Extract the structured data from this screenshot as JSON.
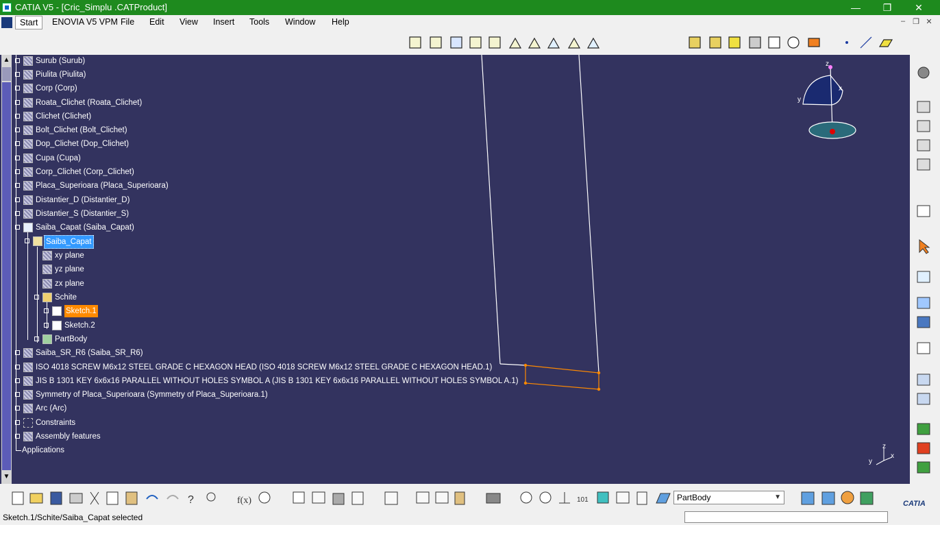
{
  "window": {
    "title": "CATIA V5 - [Cric_Simplu .CATProduct]",
    "minimize": "—",
    "maximize": "❐",
    "close": "✕"
  },
  "menu": {
    "start": "Start",
    "items": [
      "ENOVIA V5 VPM",
      "File",
      "Edit",
      "View",
      "Insert",
      "Tools",
      "Window",
      "Help"
    ]
  },
  "tree": {
    "nodes": [
      {
        "label": "Surub (Surub)"
      },
      {
        "label": "Piulita (Piulita)"
      },
      {
        "label": "Corp (Corp)"
      },
      {
        "label": "Roata_Clichet (Roata_Clichet)"
      },
      {
        "label": "Clichet (Clichet)"
      },
      {
        "label": "Bolt_Clichet (Bolt_Clichet)"
      },
      {
        "label": "Dop_Clichet (Dop_Clichet)"
      },
      {
        "label": "Cupa (Cupa)"
      },
      {
        "label": "Corp_Clichet (Corp_Clichet)"
      },
      {
        "label": "Placa_Superioara (Placa_Superioara)"
      },
      {
        "label": "Distantier_D (Distantier_D)"
      },
      {
        "label": "Distantier_S (Distantier_S)"
      },
      {
        "label": "Saiba_Capat (Saiba_Capat)"
      },
      {
        "label": "Saiba_Capat"
      },
      {
        "label": "xy plane"
      },
      {
        "label": "yz plane"
      },
      {
        "label": "zx plane"
      },
      {
        "label": "Schite"
      },
      {
        "label": "Sketch.1"
      },
      {
        "label": "Sketch.2"
      },
      {
        "label": "PartBody"
      },
      {
        "label": "Saiba_SR_R6 (Saiba_SR_R6)"
      },
      {
        "label": "ISO 4018 SCREW M6x12 STEEL GRADE C HEXAGON HEAD (ISO 4018 SCREW M6x12 STEEL GRADE C HEXAGON HEAD.1)"
      },
      {
        "label": "JIS B 1301 KEY 6x6x16 PARALLEL WITHOUT HOLES SYMBOL A (JIS B 1301 KEY 6x6x16 PARALLEL WITHOUT HOLES SYMBOL A.1)"
      },
      {
        "label": "Symmetry of Placa_Superioara (Symmetry of Placa_Superioara.1)"
      },
      {
        "label": "Arc (Arc)"
      },
      {
        "label": "Constraints"
      },
      {
        "label": "Assembly features"
      },
      {
        "label": "Applications"
      }
    ]
  },
  "compass": {
    "z": "z",
    "x": "x",
    "y": "y"
  },
  "axis_triad": {
    "z": "z",
    "x": "x",
    "y": "y"
  },
  "bottom_toolbar": {
    "current_body": "PartBody"
  },
  "status": {
    "text": "Sketch.1/Schite/Saiba_Capat selected"
  },
  "colors": {
    "titlebar": "#1e8a1e",
    "viewport": "#33335f",
    "selection_blue": "#3399ff",
    "selection_orange": "#ff8a00",
    "sketch_orange": "#ff8a00"
  },
  "icons": [
    "search-icon",
    "gear-icon",
    "arrow-cursor-icon",
    "catia-logo-icon"
  ]
}
